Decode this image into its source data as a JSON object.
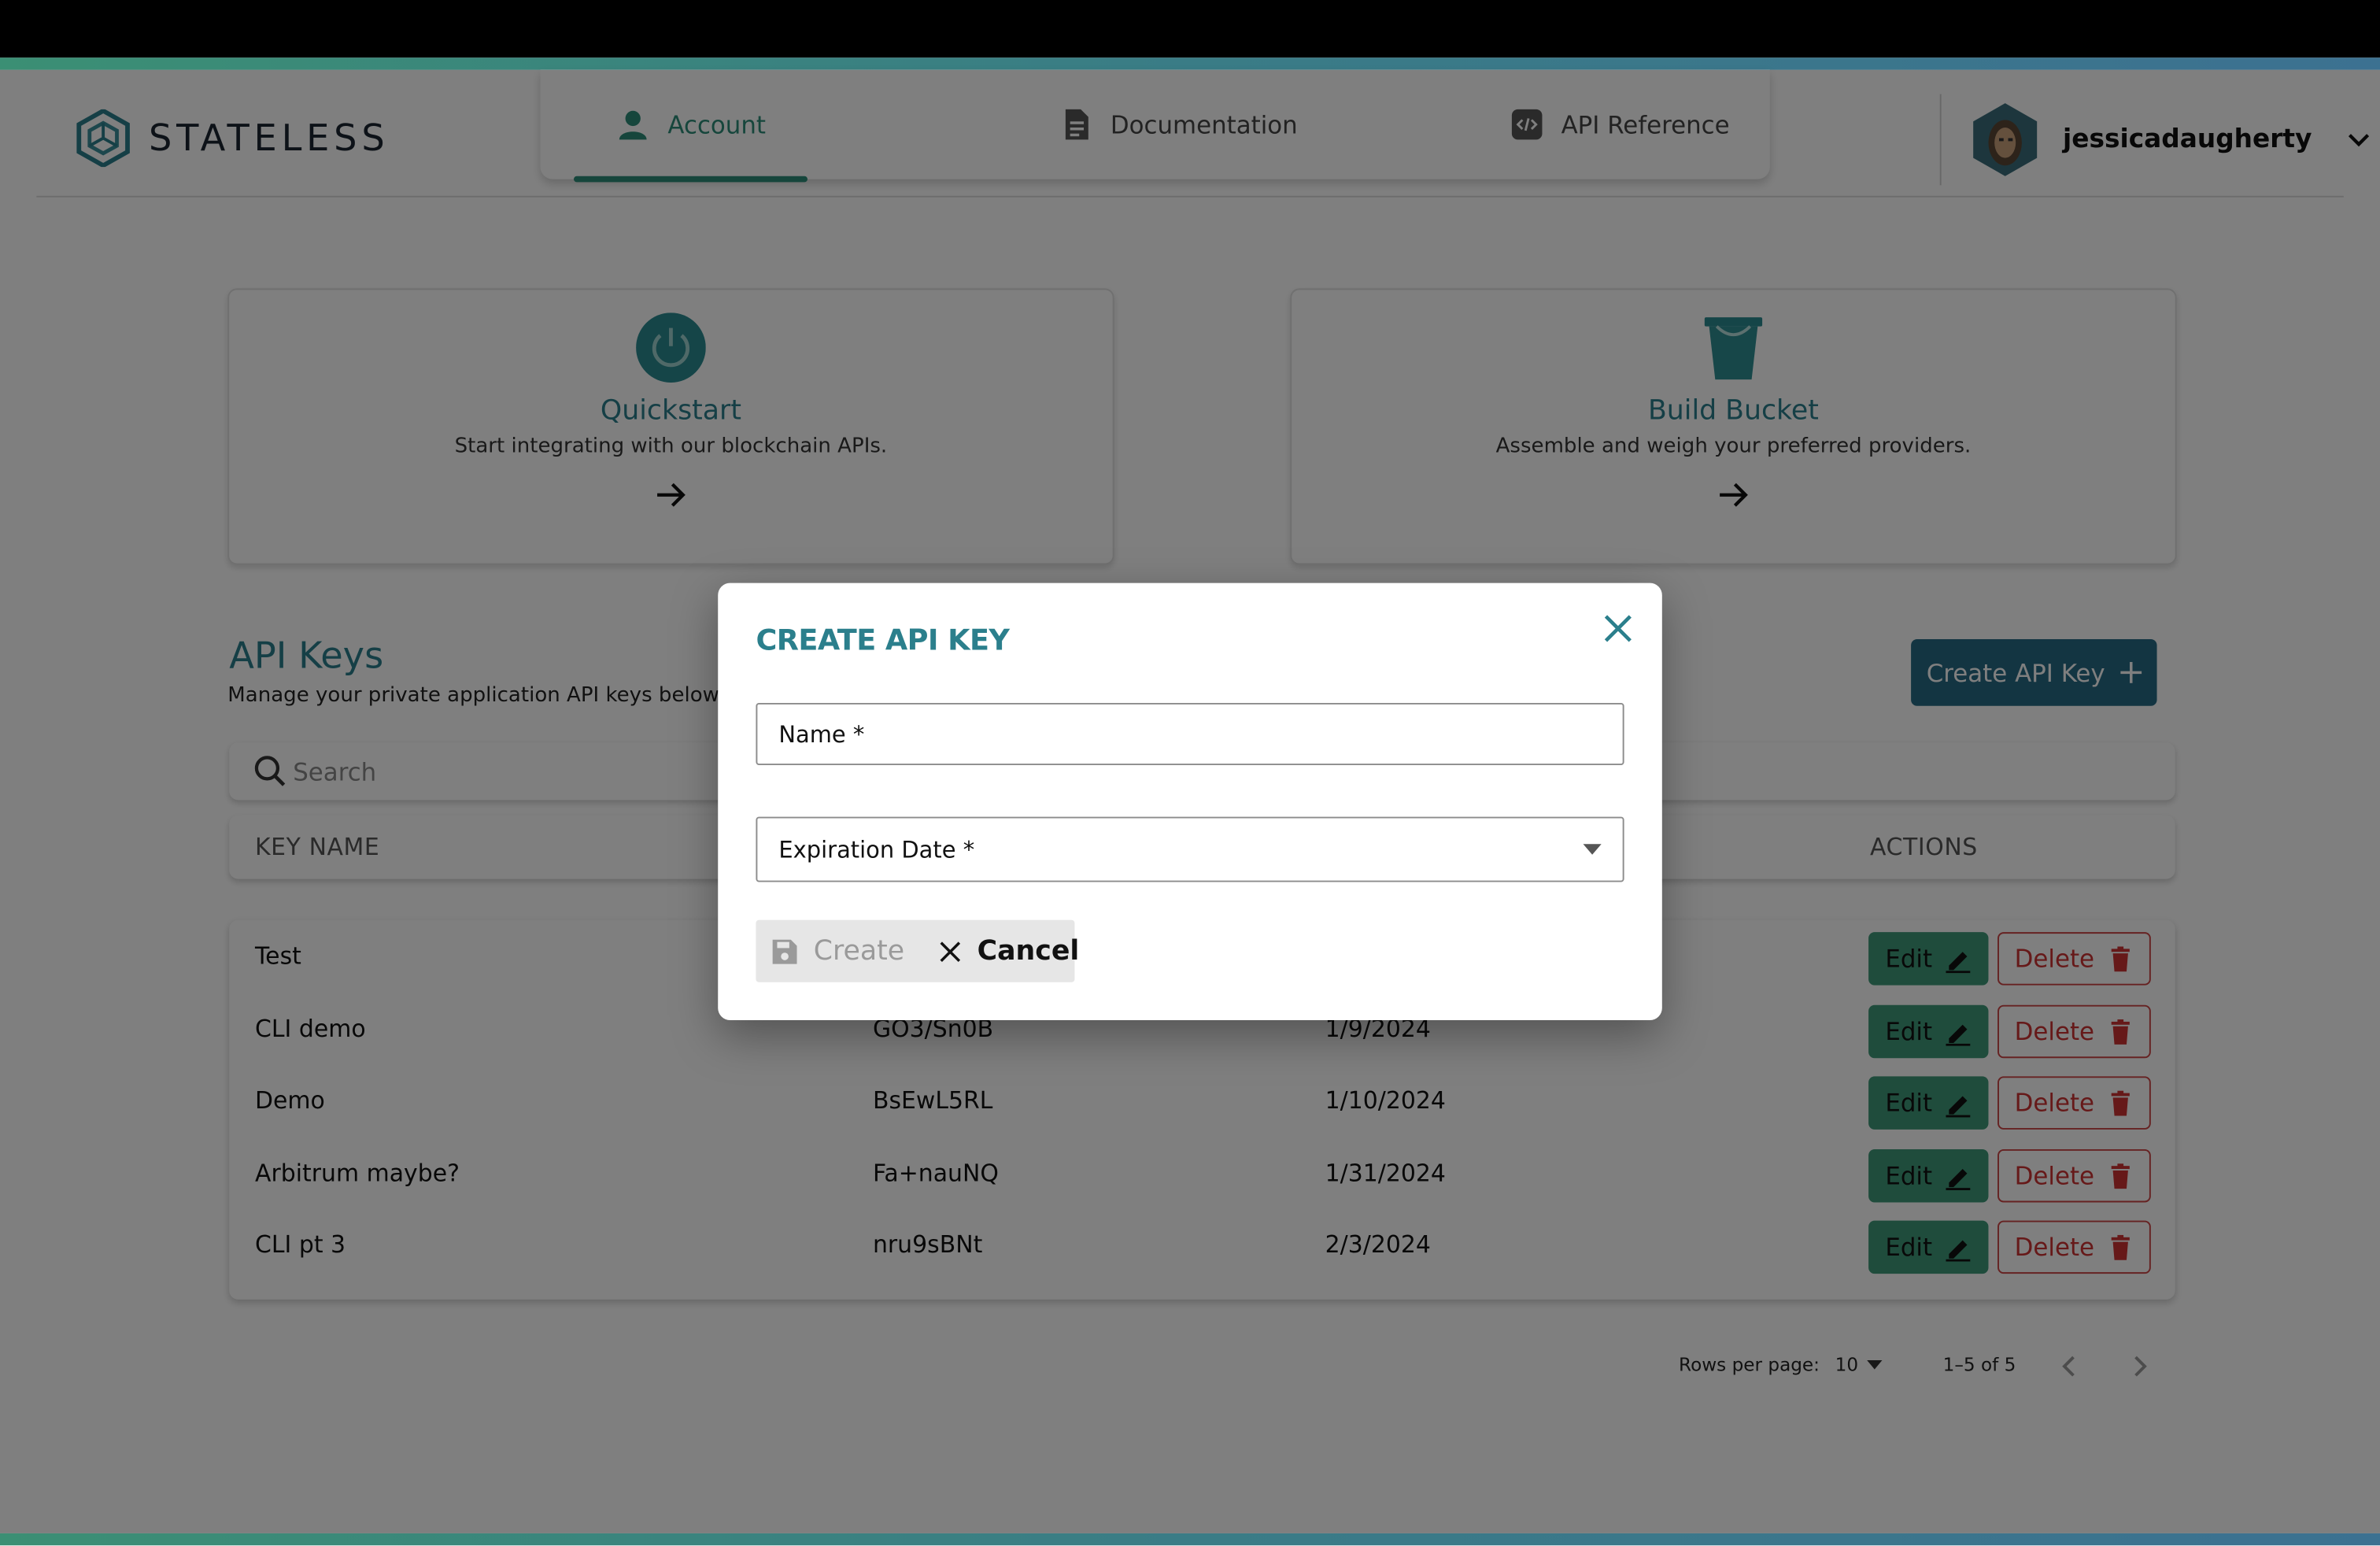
{
  "brand": {
    "name": "STATELESS"
  },
  "nav": {
    "tabs": [
      {
        "label": "Account",
        "icon": "user-icon",
        "active": true
      },
      {
        "label": "Documentation",
        "icon": "document-icon",
        "active": false
      },
      {
        "label": "API Reference",
        "icon": "code-icon",
        "active": false
      }
    ]
  },
  "user": {
    "name": "jessicadaugherty"
  },
  "cards": [
    {
      "title": "Quickstart",
      "desc": "Start integrating with our blockchain APIs.",
      "icon": "power-icon"
    },
    {
      "title": "Build Bucket",
      "desc": "Assemble and weigh your preferred providers.",
      "icon": "bucket-icon"
    }
  ],
  "api_keys": {
    "title": "API Keys",
    "subtitle": "Manage your private application API keys below. Pl",
    "create_label": "Create API Key",
    "search_placeholder": "Search",
    "columns": {
      "key_name": "KEY NAME",
      "actions": "ACTIONS"
    },
    "rows": [
      {
        "name": "Test",
        "key": "",
        "date": ""
      },
      {
        "name": "CLI demo",
        "key": "GO3/Sn0B",
        "date": "1/9/2024"
      },
      {
        "name": "Demo",
        "key": "BsEwL5RL",
        "date": "1/10/2024"
      },
      {
        "name": "Arbitrum maybe?",
        "key": "Fa+nauNQ",
        "date": "1/31/2024"
      },
      {
        "name": "CLI pt 3",
        "key": "nru9sBNt",
        "date": "2/3/2024"
      }
    ],
    "edit_label": "Edit",
    "delete_label": "Delete"
  },
  "pagination": {
    "rows_per_page_label": "Rows per page:",
    "rows_per_page": "10",
    "range": "1–5 of 5"
  },
  "modal": {
    "title": "CREATE API KEY",
    "name_label": "Name *",
    "expiration_label": "Expiration Date *",
    "create_label": "Create",
    "cancel_label": "Cancel"
  },
  "colors": {
    "accent_teal": "#2b7f8c",
    "nav_active": "#2c8c78",
    "primary_button": "#276b84",
    "edit_button": "#3f9878",
    "delete_red": "#c33333"
  }
}
